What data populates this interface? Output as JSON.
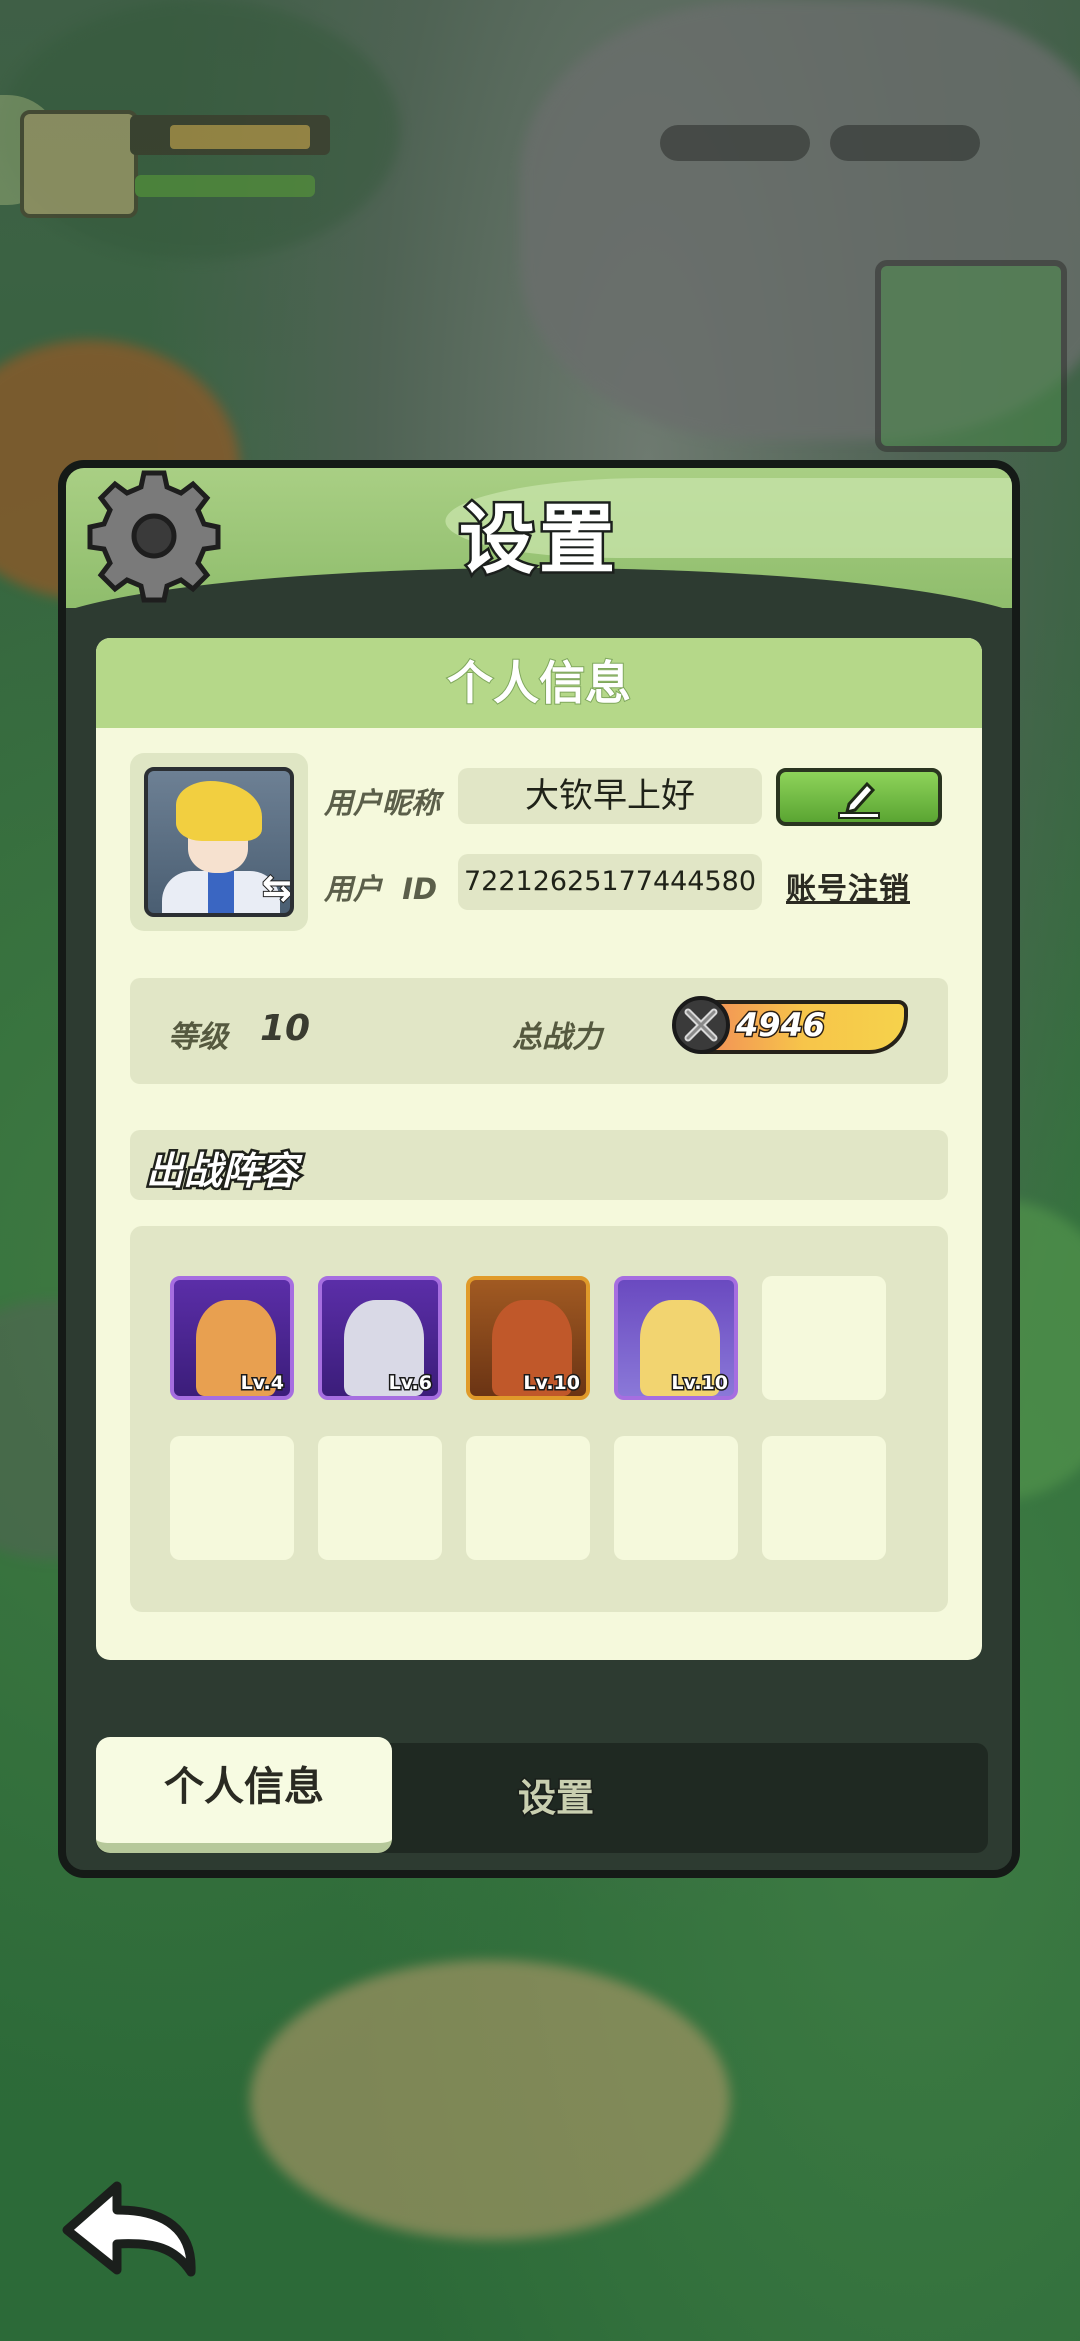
{
  "panel": {
    "title": "设置",
    "card_title": "个人信息"
  },
  "profile": {
    "nickname_label": "用户昵称",
    "nickname": "大钦早上好",
    "id_label": "用户  ID",
    "user_id": "72212625177444580",
    "cancel_account_label": "账号注销",
    "level_label": "等级",
    "level": "10",
    "power_label": "总战力",
    "power": "4946"
  },
  "lineup": {
    "title": "出战阵容",
    "heroes": [
      {
        "level": "Lv.4",
        "rarity": "purple"
      },
      {
        "level": "Lv.6",
        "rarity": "purple"
      },
      {
        "level": "Lv.10",
        "rarity": "gold"
      },
      {
        "level": "Lv.10",
        "rarity": "purple"
      }
    ],
    "total_slots": 10
  },
  "tabs": {
    "active": "个人信息",
    "inactive": "设置"
  },
  "colors": {
    "header": "#a9cf84",
    "card": "#f5f9dc",
    "field": "#e1e6c6",
    "edit_button": "#6dbb40",
    "purple_frame": "#a66ee0",
    "gold_frame": "#e09a2a"
  },
  "icons": [
    "gear-icon",
    "pen-icon",
    "swap-icon",
    "crossed-swords-icon",
    "back-arrow-icon"
  ]
}
